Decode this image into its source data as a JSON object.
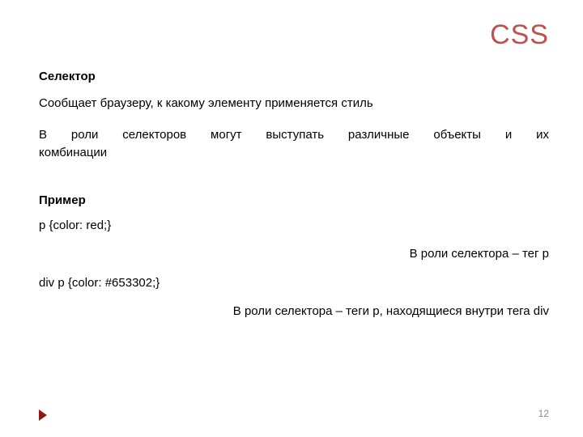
{
  "title": {
    "text": "CSS",
    "color": "#c0504d"
  },
  "content": {
    "heading1": "Селектор",
    "p1": "Сообщает браузеру, к какому элементу применяется стиль",
    "p2_line1": "В роли селекторов могут выступать различные объекты и их",
    "p2_line2": "комбинации",
    "heading2": "Пример",
    "code1": "p {color: red;}",
    "note1": "В роли селектора – тег p",
    "code2": "div p {color: #653302;}",
    "note2": "В роли селектора – теги p, находящиеся внутри тега div"
  },
  "pageNumber": "12"
}
